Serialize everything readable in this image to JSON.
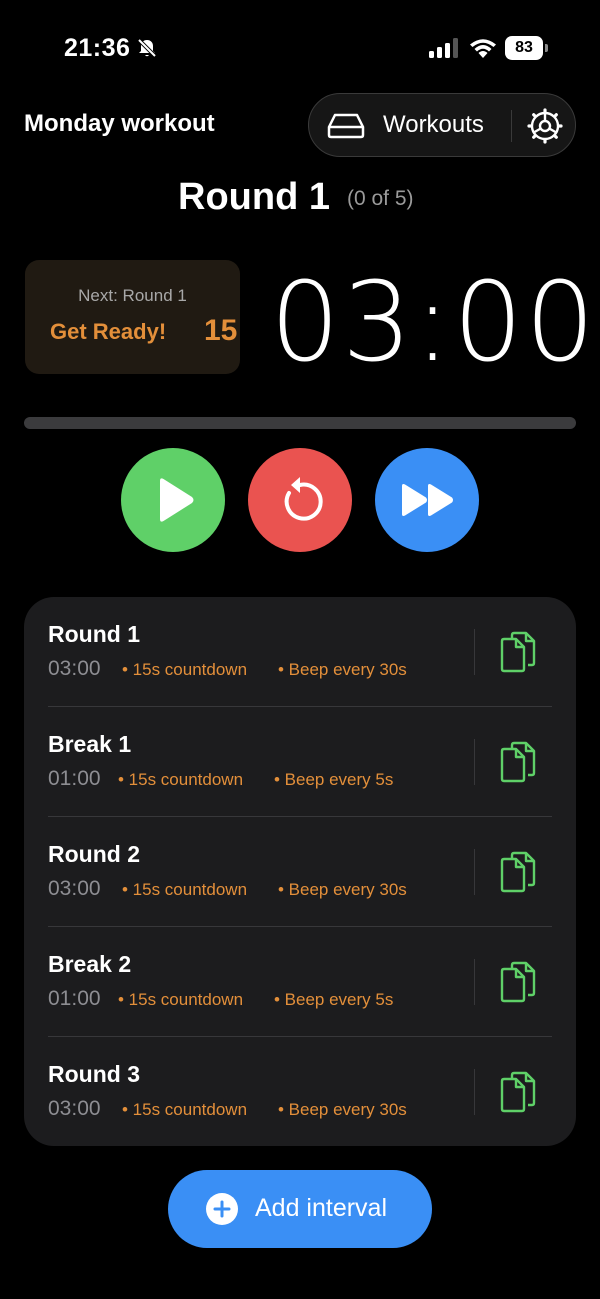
{
  "status_bar": {
    "time": "21:36",
    "battery": "83",
    "icons": [
      "bell-slash-icon",
      "signal-icon",
      "wifi-icon",
      "battery-icon"
    ]
  },
  "header": {
    "workout_name": "Monday workout",
    "workouts_label": "Workouts",
    "icons": [
      "drive-icon",
      "gear-icon"
    ]
  },
  "round": {
    "title": "Round 1",
    "progress": "(0 of 5)"
  },
  "next_card": {
    "next_label": "Next: Round 1",
    "ready_label": "Get Ready!",
    "countdown": "15"
  },
  "timer": {
    "display": "03:00",
    "progress_fraction": 0
  },
  "controls": {
    "icons": [
      "play-icon",
      "reset-icon",
      "skip-forward-icon"
    ]
  },
  "intervals": [
    {
      "name": "Round 1",
      "duration": "03:00",
      "countdown": "• 15s countdown",
      "beep": "• Beep every 30s"
    },
    {
      "name": "Break 1",
      "duration": "01:00",
      "countdown": "• 15s countdown",
      "beep": "• Beep every 5s"
    },
    {
      "name": "Round 2",
      "duration": "03:00",
      "countdown": "• 15s countdown",
      "beep": "• Beep every 30s"
    },
    {
      "name": "Break 2",
      "duration": "01:00",
      "countdown": "• 15s countdown",
      "beep": "• Beep every 5s"
    },
    {
      "name": "Round 3",
      "duration": "03:00",
      "countdown": "• 15s countdown",
      "beep": "• Beep every 30s"
    }
  ],
  "add_button": {
    "label": "Add interval"
  },
  "colors": {
    "accent_orange": "#e38f3a",
    "play_green": "#5fd068",
    "reset_red": "#ea5350",
    "skip_blue": "#3a8ff5",
    "copy_green": "#5fd068"
  }
}
